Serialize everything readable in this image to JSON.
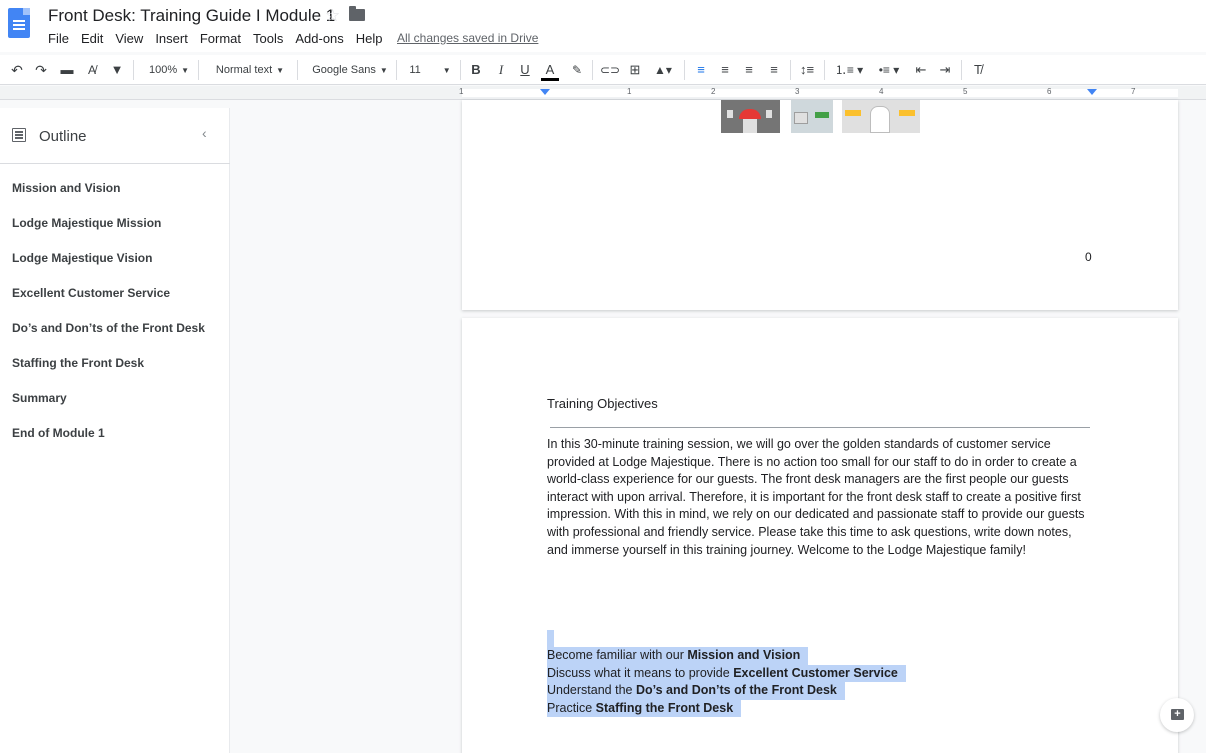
{
  "app": {
    "doc_title": "Front Desk: Training Guide I Module 1",
    "saved_status": "All changes saved in Drive"
  },
  "menubar": {
    "items": [
      {
        "label": "File"
      },
      {
        "label": "Edit"
      },
      {
        "label": "View"
      },
      {
        "label": "Insert"
      },
      {
        "label": "Format"
      },
      {
        "label": "Tools"
      },
      {
        "label": "Add-ons"
      },
      {
        "label": "Help"
      }
    ]
  },
  "toolbar": {
    "zoom": "100%",
    "style": "Normal text",
    "font": "Google Sans",
    "font_size": "11",
    "bold": "B",
    "italic": "I",
    "underline": "U",
    "text_color": "A",
    "icons": [
      "undo-icon",
      "redo-icon",
      "print-icon",
      "spellcheck-icon",
      "paint-format-icon",
      "highlight-icon",
      "link-icon",
      "add-comment-icon",
      "insert-image-icon",
      "align-left-icon",
      "align-center-icon",
      "align-right-icon",
      "justify-icon",
      "line-spacing-icon",
      "numbered-list-icon",
      "bulleted-list-icon",
      "decrease-indent-icon",
      "increase-indent-icon",
      "clear-formatting-icon"
    ]
  },
  "ruler": {
    "numbers": [
      "1",
      "1",
      "2",
      "3",
      "4",
      "5",
      "6",
      "7"
    ]
  },
  "outline": {
    "title": "Outline",
    "items": [
      {
        "label": "Mission and Vision"
      },
      {
        "label": "Lodge Majestique Mission"
      },
      {
        "label": "Lodge Majestique Vision"
      },
      {
        "label": "Excellent Customer Service"
      },
      {
        "label": "Do’s and Don’ts of the Front Desk"
      },
      {
        "label": "Staffing the Front Desk"
      },
      {
        "label": "Summary"
      },
      {
        "label": "End of Module 1"
      }
    ]
  },
  "document": {
    "page1_number": "0",
    "section_title": "Training Objectives",
    "intro_paragraph": "In this 30-minute training session, we will  go over the golden standards of customer service provided at Lodge Majestique. There is no action too small for our staff to do in order to create a world-class experience for our guests. The front desk managers are the first people our guests interact with upon arrival. Therefore, it is important for the front desk staff to create a positive first impression. With this in mind, we rely on our dedicated and passionate staff to provide our guests with professional and friendly service. Please take this time to ask questions, write down notes, and immerse yourself in this training journey. Welcome to the Lodge Majestique family!",
    "objectives": [
      {
        "prefix": "Become familiar with our ",
        "bold": "Mission and Vision"
      },
      {
        "prefix": "Discuss what it means to provide  ",
        "bold": "Excellent Customer Service"
      },
      {
        "prefix": "Understand the ",
        "bold": "Do’s and Don’ts of the Front Desk"
      },
      {
        "prefix": "Practice ",
        "bold": "Staffing the Front Desk"
      }
    ]
  },
  "colors": {
    "selection": "#bcd3f7",
    "docs_blue": "#4285f4"
  }
}
